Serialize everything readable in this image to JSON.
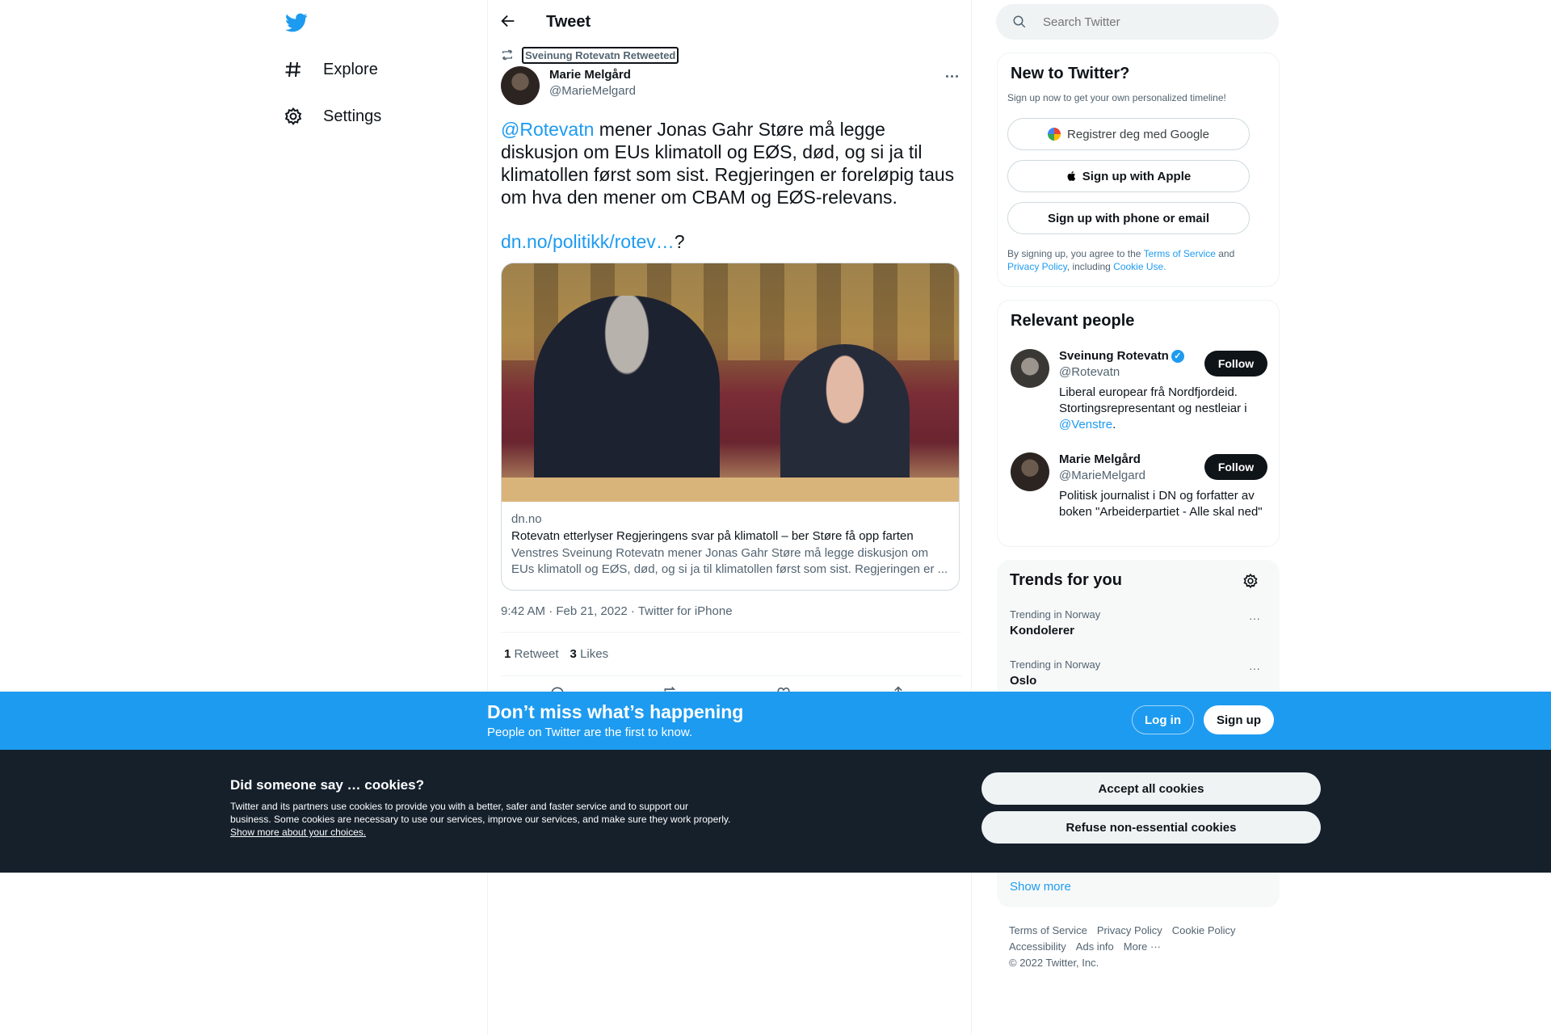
{
  "nav": {
    "explore": "Explore",
    "settings": "Settings"
  },
  "header": {
    "title": "Tweet"
  },
  "search": {
    "placeholder": "Search Twitter"
  },
  "tweet": {
    "retweeted_by": "Sveinung Rotevatn Retweeted",
    "author_name": "Marie Melgård",
    "author_handle": "@MarieMelgard",
    "mention": "@Rotevatn",
    "body": " mener Jonas Gahr Støre må legge diskusjon om EUs klimatoll og EØS, død, og si ja til klimatollen først som sist. Regjeringen er foreløpig taus om hva den mener om CBAM og EØS-relevans.",
    "link": "dn.no/politikk/rotev…",
    "link_suffix": "?",
    "card": {
      "domain": "dn.no",
      "title": "Rotevatn etterlyser Regjeringens svar på klimatoll – ber Støre få opp farten",
      "description": "Venstres Sveinung Rotevatn mener Jonas Gahr Støre må legge diskusjon om EUs klimatoll og EØS, død, og si ja til klimatollen først som sist. Regjeringen er ..."
    },
    "timestamp": "9:42 AM · Feb 21, 2022 · Twitter for iPhone",
    "retweets_count": "1",
    "retweets_label": "Retweet",
    "likes_count": "3",
    "likes_label": "Likes"
  },
  "signup": {
    "title": "New to Twitter?",
    "subtitle": "Sign up now to get your own personalized timeline!",
    "google": "Registrer deg med Google",
    "apple": "Sign up with Apple",
    "phone": "Sign up with phone or email",
    "terms_prefix": "By signing up, you agree to the ",
    "terms_link": "Terms of Service",
    "terms_and": " and",
    "privacy_link": "Privacy Policy",
    "including": ", including ",
    "cookie_link": "Cookie Use."
  },
  "relevant": {
    "title": "Relevant people",
    "people": [
      {
        "name": "Sveinung Rotevatn",
        "handle": "@Rotevatn",
        "bio": "Liberal europear frå Nordfjordeid. Stortingsrepresentant og nestleiar i ",
        "bio_link": "@Venstre",
        "bio_end": ".",
        "follow": "Follow"
      },
      {
        "name": "Marie Melgård",
        "handle": "@MarieMelgard",
        "bio": "Politisk journalist i DN og forfatter av boken \"Arbeiderpartiet - Alle skal ned\"",
        "follow": "Follow"
      }
    ]
  },
  "trends": {
    "title": "Trends for you",
    "items": [
      {
        "category": "Trending in Norway",
        "name": "Kondolerer"
      },
      {
        "category": "Trending in Norway",
        "name": "Oslo"
      }
    ],
    "show_more": "Show more"
  },
  "footer": {
    "links_row1": [
      "Terms of Service",
      "Privacy Policy",
      "Cookie Policy"
    ],
    "links_row2": [
      "Accessibility",
      "Ads info",
      "More ···"
    ],
    "copyright": "© 2022 Twitter, Inc."
  },
  "banner": {
    "title": "Don’t miss what’s happening",
    "subtitle": "People on Twitter are the first to know.",
    "login": "Log in",
    "signup": "Sign up"
  },
  "cookies": {
    "title": "Did someone say … cookies?",
    "body": "Twitter and its partners use cookies to provide you with a better, safer and faster service and to support our business. Some cookies are necessary to use our services, improve our services, and make sure they work properly. ",
    "link": "Show more about your choices.",
    "accept": "Accept all cookies",
    "refuse": "Refuse non-essential cookies"
  },
  "colors": {
    "accent": "#1d9bf0",
    "banner": "#1d9bf0",
    "cookie_bg": "#15202b"
  }
}
